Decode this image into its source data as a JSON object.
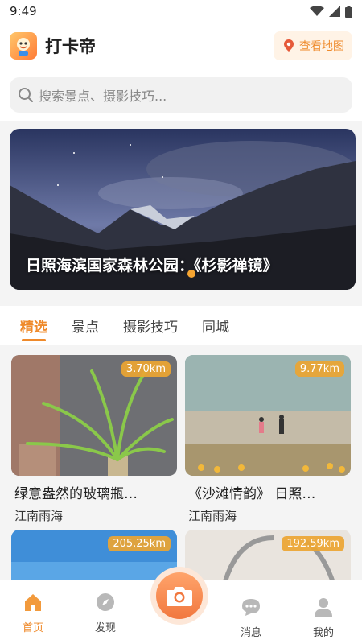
{
  "status": {
    "time": "9:49"
  },
  "header": {
    "app_name": "打卡帝",
    "map_button_label": "查看地图"
  },
  "search": {
    "placeholder": "搜索景点、摄影技巧..."
  },
  "banner": {
    "title": "日照海滨国家森林公园：《杉影禅镜》"
  },
  "tabs": [
    {
      "label": "精选",
      "active": true
    },
    {
      "label": "景点"
    },
    {
      "label": "摄影技巧"
    },
    {
      "label": "同城"
    }
  ],
  "cards": [
    {
      "distance": "3.70km",
      "title": "绿意盎然的玻璃瓶…",
      "author": "江南雨海"
    },
    {
      "distance": "9.77km",
      "title": "《沙滩情韵》 日照…",
      "author": "江南雨海"
    },
    {
      "distance": "205.25km"
    },
    {
      "distance": "192.59km"
    }
  ],
  "nav": [
    {
      "label": "首页",
      "icon": "home-icon",
      "active": true
    },
    {
      "label": "发现",
      "icon": "compass-icon"
    },
    {
      "label": "消息",
      "icon": "chat-icon"
    },
    {
      "label": "我的",
      "icon": "user-icon"
    }
  ],
  "colors": {
    "accent": "#ef8a2b"
  }
}
